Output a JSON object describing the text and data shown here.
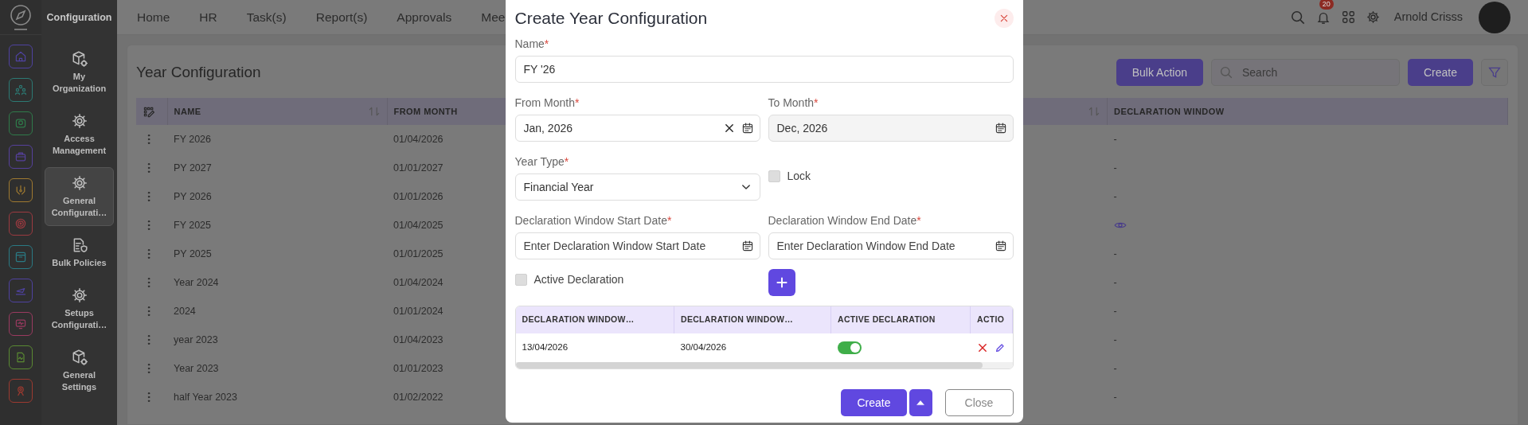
{
  "app_title": "Configuration",
  "rail": [
    {
      "kind": "home",
      "color": "#4f42a0"
    },
    {
      "kind": "people",
      "color": "#2c7a74"
    },
    {
      "kind": "tray",
      "color": "#2f7a4a"
    },
    {
      "kind": "briefcase",
      "color": "#56419c"
    },
    {
      "kind": "hands",
      "color": "#a07a30"
    },
    {
      "kind": "target",
      "color": "#9c3a40"
    },
    {
      "kind": "archive",
      "color": "#2a7a84"
    },
    {
      "kind": "plane",
      "color": "#4f42a0"
    },
    {
      "kind": "monitor",
      "color": "#9a3a60"
    },
    {
      "kind": "document",
      "color": "#5a8a32"
    },
    {
      "kind": "badge",
      "color": "#9c3a30"
    }
  ],
  "sub_sidebar": [
    {
      "label": "My Organization",
      "kind": "box-gear",
      "selected": false
    },
    {
      "label": "Access Management",
      "kind": "gear",
      "selected": false
    },
    {
      "label": "General Configurati…",
      "kind": "gear",
      "selected": true
    },
    {
      "label": "Bulk Policies",
      "kind": "doc-shield",
      "selected": false
    },
    {
      "label": "Setups Configurati…",
      "kind": "gear",
      "selected": false
    },
    {
      "label": "General Settings",
      "kind": "box-gear",
      "selected": false
    }
  ],
  "nav_menu": [
    "Home",
    "HR",
    "Task(s)",
    "Report(s)",
    "Approvals",
    "Mee"
  ],
  "header": {
    "notification_count": "20",
    "user_name": "Arnold Crisss"
  },
  "page": {
    "title": "Year Configuration",
    "bulk_action": "Bulk Action",
    "search_placeholder": "Search",
    "create": "Create"
  },
  "table": {
    "columns": [
      {
        "label": "NAME",
        "sortable": true
      },
      {
        "label": "FROM MONTH"
      },
      {
        "sortable": true
      },
      {
        "label": "DECLARATION WINDOW",
        "sortable": false
      }
    ],
    "rows": [
      {
        "name": "FY 2026",
        "from_month": "01/04/2026",
        "declaration_window": "-"
      },
      {
        "name": "PY 2027",
        "from_month": "01/01/2027",
        "declaration_window": "-"
      },
      {
        "name": "PY 2026",
        "from_month": "01/01/2026",
        "declaration_window": "-"
      },
      {
        "name": "FY 2025",
        "from_month": "01/04/2025",
        "view_icon": true
      },
      {
        "name": "PY 2025",
        "from_month": "01/01/2025",
        "declaration_window": "-"
      },
      {
        "name": "Year 2024",
        "from_month": "01/04/2024",
        "declaration_window": "-"
      },
      {
        "name": "2024",
        "from_month": "01/01/2024",
        "declaration_window": "-"
      },
      {
        "name": "year 2023",
        "from_month": "01/04/2023",
        "declaration_window": "-"
      },
      {
        "name": "Year 2023",
        "from_month": "01/01/2023",
        "declaration_window": "-"
      },
      {
        "name": "half Year 2023",
        "from_month": "01/02/2022",
        "declaration_window": "-"
      }
    ]
  },
  "modal": {
    "title": "Create Year Configuration",
    "name": {
      "label": "Name",
      "required_mark": "*",
      "value": "FY '26"
    },
    "from_month": {
      "label": "From Month",
      "required_mark": "*",
      "value": "Jan, 2026",
      "clearable": true
    },
    "to_month": {
      "label": "To Month",
      "required_mark": "*",
      "value": "Dec, 2026",
      "disabled": true
    },
    "year_type": {
      "label": "Year Type",
      "required_mark": "*",
      "value": "Financial Year"
    },
    "lock": {
      "label": "Lock",
      "checked": false
    },
    "decl_start": {
      "label": "Declaration Window Start Date",
      "required_mark": "*",
      "placeholder": "Enter Declaration Window Start Date"
    },
    "decl_end": {
      "label": "Declaration Window End Date",
      "required_mark": "*",
      "placeholder": "Enter Declaration Window End Date"
    },
    "active_declaration": {
      "label": "Active Declaration",
      "checked": false
    },
    "windows_table": {
      "columns": [
        "DECLARATION WINDOW…",
        "DECLARATION WINDOW…",
        "ACTIVE DECLARATION",
        "ACTIO"
      ],
      "rows": [
        {
          "start": "13/04/2026",
          "end": "30/04/2026",
          "active": true
        }
      ]
    },
    "create": "Create",
    "close": "Close"
  }
}
